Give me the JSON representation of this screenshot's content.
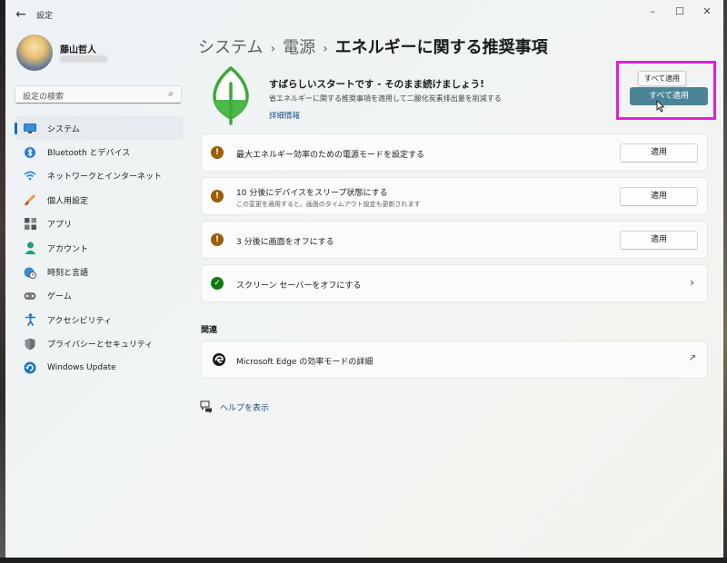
{
  "window": {
    "title": "設定"
  },
  "user": {
    "name": "藤山哲人"
  },
  "search": {
    "placeholder": "設定の検索"
  },
  "sidebar": {
    "items": [
      {
        "label": "システム",
        "icon": "monitor-icon",
        "active": true
      },
      {
        "label": "Bluetooth とデバイス",
        "icon": "bluetooth-icon"
      },
      {
        "label": "ネットワークとインターネット",
        "icon": "wifi-icon"
      },
      {
        "label": "個人用設定",
        "icon": "brush-icon"
      },
      {
        "label": "アプリ",
        "icon": "apps-icon"
      },
      {
        "label": "アカウント",
        "icon": "person-icon"
      },
      {
        "label": "時刻と言語",
        "icon": "globe-clock-icon"
      },
      {
        "label": "ゲーム",
        "icon": "gamepad-icon"
      },
      {
        "label": "アクセシビリティ",
        "icon": "accessibility-icon"
      },
      {
        "label": "プライバシーとセキュリティ",
        "icon": "shield-icon"
      },
      {
        "label": "Windows Update",
        "icon": "update-icon"
      }
    ]
  },
  "breadcrumb": {
    "part1": "システム",
    "part2": "電源",
    "current": "エネルギーに関する推奨事項"
  },
  "hero": {
    "title": "すばらしいスタートです - そのまま続けましょう!",
    "subtitle": "省エネルギーに関する推奨事項を適用して二酸化炭素排出量を削減する",
    "link": "詳細情報",
    "apply_all_label": "すべて適用",
    "tooltip": "すべて適用"
  },
  "recommendations": [
    {
      "title": "最大エネルギー効率のための電源モードを設定する",
      "button": "適用",
      "status": "warning"
    },
    {
      "title": "10 分後にデバイスをスリープ状態にする",
      "desc": "この変更を適用すると、画面のタイムアウト設定も更新されます",
      "button": "適用",
      "status": "warning"
    },
    {
      "title": "3 分後に画面をオフにする",
      "button": "適用",
      "status": "warning"
    },
    {
      "title": "スクリーン セーバーをオフにする",
      "status": "ok"
    }
  ],
  "related": {
    "heading": "関連",
    "items": [
      {
        "label": "Microsoft Edge の効率モードの詳細"
      }
    ]
  },
  "help": {
    "label": "ヘルプを表示"
  },
  "colors": {
    "accent": "#4b8497",
    "warning": "#9d5d00",
    "ok": "#0f7b0f",
    "highlight": "#e020d0"
  }
}
